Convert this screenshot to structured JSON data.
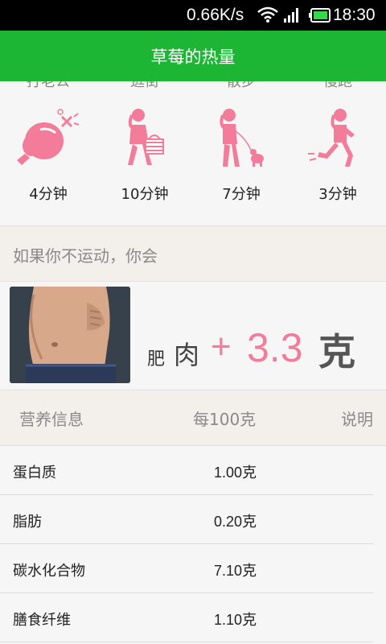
{
  "status_bar": {
    "network_speed": "0.66K/s",
    "time": "18:30",
    "icons": [
      "wifi-icon",
      "signal-icon",
      "battery-icon"
    ]
  },
  "header": {
    "title": "草莓的热量"
  },
  "exercise_section": {
    "partial_labels": [
      "打老公",
      "逛街",
      "散步",
      "慢跑"
    ],
    "items": [
      {
        "icon": "boxing-glove-icon",
        "duration": "4分钟"
      },
      {
        "icon": "shopping-woman-icon",
        "duration": "10分钟"
      },
      {
        "icon": "walking-dog-icon",
        "duration": "7分钟"
      },
      {
        "icon": "jogging-icon",
        "duration": "3分钟"
      }
    ]
  },
  "no_exercise": {
    "heading": "如果你不运动，你会",
    "label_small": "肥",
    "label_big": "肉",
    "plus": "+",
    "value": "3.3",
    "unit": "克"
  },
  "nutrition": {
    "headers": [
      "营养信息",
      "每100克",
      "说明"
    ],
    "rows": [
      {
        "name": "蛋白质",
        "value": "1.00克"
      },
      {
        "name": "脂肪",
        "value": "0.20克"
      },
      {
        "name": "碳水化合物",
        "value": "7.10克"
      },
      {
        "name": "膳食纤维",
        "value": "1.10克"
      }
    ]
  },
  "colors": {
    "accent_green": "#1db634",
    "pink": "#f27c9a",
    "band_bg": "#f3efeb"
  }
}
